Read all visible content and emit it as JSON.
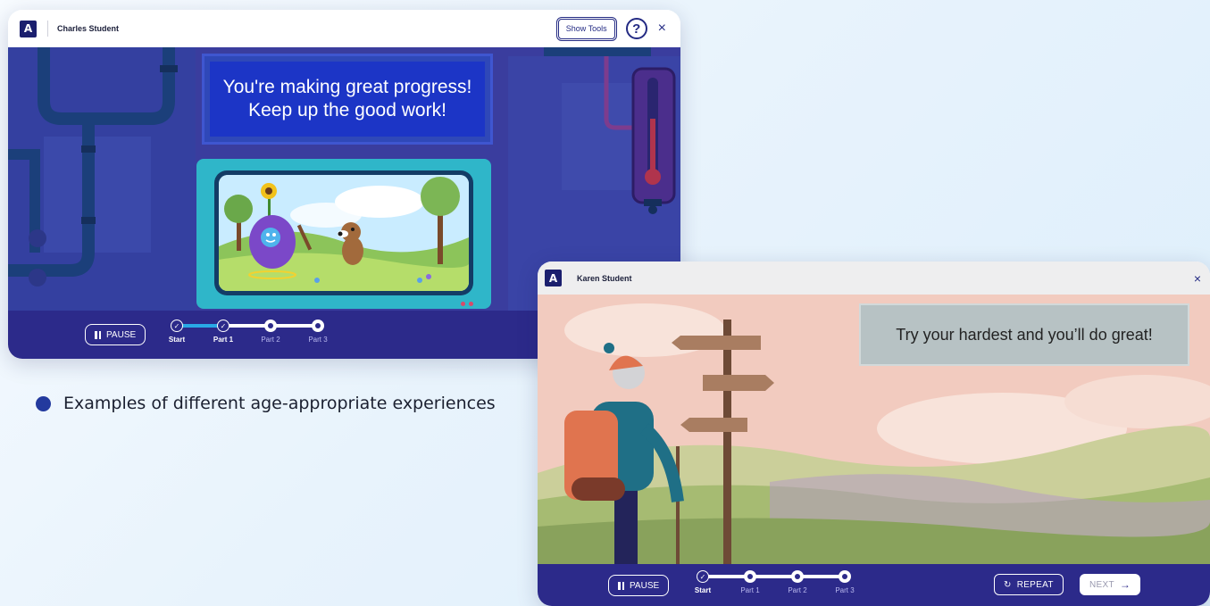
{
  "bullet": {
    "text": "Examples of different age-appropriate experiences"
  },
  "window1": {
    "logo": "A",
    "student_name": "Charles Student",
    "show_tools": "Show Tools",
    "help": "?",
    "close": "×",
    "banner_line1": "You're making great progress!",
    "banner_line2": "Keep up the good work!",
    "pause_label": "PAUSE",
    "steps": [
      {
        "label": "Start",
        "state": "done"
      },
      {
        "label": "Part 1",
        "state": "done"
      },
      {
        "label": "Part 2",
        "state": "todo"
      },
      {
        "label": "Part 3",
        "state": "todo"
      }
    ]
  },
  "window2": {
    "logo": "A",
    "student_name": "Karen Student",
    "close": "×",
    "banner": "Try your hardest and you’ll do great!",
    "pause_label": "PAUSE",
    "repeat_label": "REPEAT",
    "next_label": "NEXT",
    "steps": [
      {
        "label": "Start",
        "state": "done"
      },
      {
        "label": "Part 1",
        "state": "todo"
      },
      {
        "label": "Part 2",
        "state": "todo"
      },
      {
        "label": "Part 3",
        "state": "todo"
      }
    ]
  },
  "colors": {
    "brand_navy": "#1b1f6e",
    "control_bar": "#2c2a8a",
    "progress_done": "#29a9e6",
    "bullet": "#233a9e"
  },
  "icons": {
    "help": "help-circle-icon",
    "close": "close-icon",
    "pause": "pause-icon",
    "repeat": "repeat-icon",
    "next": "arrow-right-icon",
    "check": "check-icon"
  }
}
